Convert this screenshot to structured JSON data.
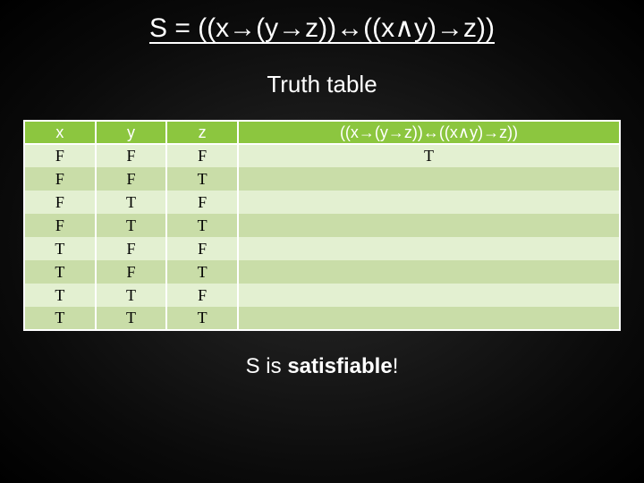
{
  "title": "S = ((x→(y→z))↔((x∧y)→z))",
  "subtitle": "Truth table",
  "headers": [
    "x",
    "y",
    "z",
    "((x→(y→z))↔((x∧y)→z))"
  ],
  "rows": [
    {
      "x": "F",
      "y": "F",
      "z": "F",
      "s": "T"
    },
    {
      "x": "F",
      "y": "F",
      "z": "T",
      "s": ""
    },
    {
      "x": "F",
      "y": "T",
      "z": "F",
      "s": ""
    },
    {
      "x": "F",
      "y": "T",
      "z": "T",
      "s": ""
    },
    {
      "x": "T",
      "y": "F",
      "z": "F",
      "s": ""
    },
    {
      "x": "T",
      "y": "F",
      "z": "T",
      "s": ""
    },
    {
      "x": "T",
      "y": "T",
      "z": "F",
      "s": ""
    },
    {
      "x": "T",
      "y": "T",
      "z": "T",
      "s": ""
    }
  ],
  "footer": {
    "pre": "S is ",
    "bold": "satisfiable",
    "post": "!"
  },
  "chart_data": {
    "type": "table",
    "title": "Truth table",
    "columns": [
      "x",
      "y",
      "z",
      "((x→(y→z))↔((x∧y)→z))"
    ],
    "rows": [
      [
        "F",
        "F",
        "F",
        "T"
      ],
      [
        "F",
        "F",
        "T",
        ""
      ],
      [
        "F",
        "T",
        "F",
        ""
      ],
      [
        "F",
        "T",
        "T",
        ""
      ],
      [
        "T",
        "F",
        "F",
        ""
      ],
      [
        "T",
        "F",
        "T",
        ""
      ],
      [
        "T",
        "T",
        "F",
        ""
      ],
      [
        "T",
        "T",
        "T",
        ""
      ]
    ]
  }
}
